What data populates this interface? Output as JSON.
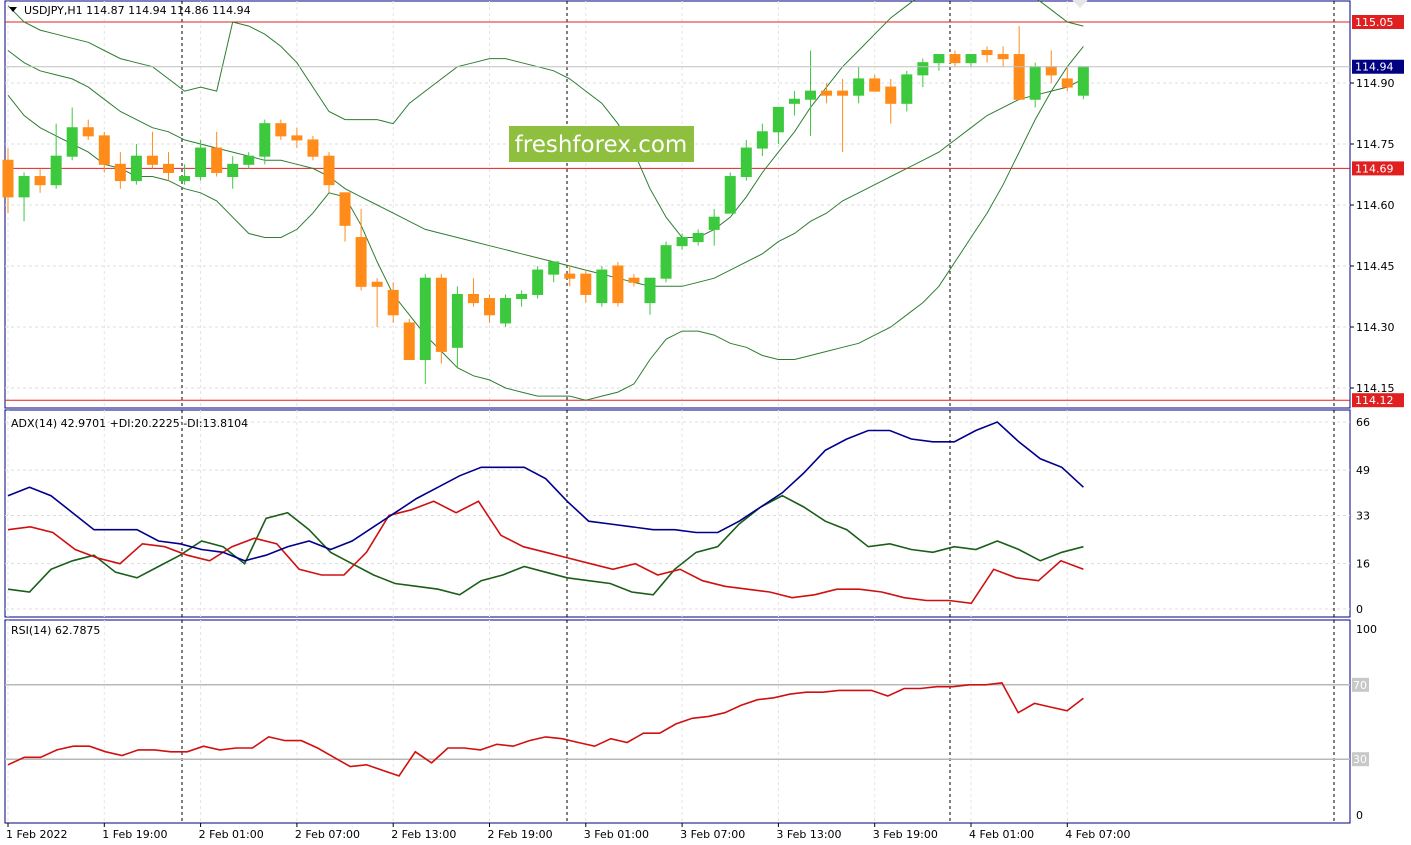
{
  "chart_data": {
    "type": "candlestick",
    "symbol_header": "USDJPY,H1  114.87 114.94 114.86 114.94",
    "watermark": "freshforex.com",
    "colors": {
      "bull": "#3dc93d",
      "bear": "#ff8c1a",
      "frame": "#000080",
      "hline": "#e02020",
      "hline_label_bg": "#e02020",
      "price_label_bg": "#000080",
      "bands": "#2e7d32",
      "adx": "#00008b",
      "plus_di": "#1a5e1a",
      "minus_di": "#d01010",
      "rsi": "#d01010",
      "watermark_bg": "#8fbf3f"
    },
    "main_panel": {
      "ylim": [
        114.1,
        115.1
      ],
      "y_ticks": [
        "114.90",
        "114.75",
        "114.60",
        "114.45",
        "114.30",
        "114.15"
      ],
      "y_tick_values": [
        114.9,
        114.75,
        114.6,
        114.45,
        114.3,
        114.15
      ],
      "horizontal_lines": [
        {
          "value": 115.05,
          "label": "115.05"
        },
        {
          "value": 114.69,
          "label": "114.69"
        },
        {
          "value": 114.12,
          "label": "114.12"
        }
      ],
      "current_price": {
        "value": 114.94,
        "label": "114.94"
      },
      "candles": [
        [
          114.71,
          114.74,
          114.58,
          114.62
        ],
        [
          114.62,
          114.68,
          114.56,
          114.67
        ],
        [
          114.67,
          114.69,
          114.63,
          114.65
        ],
        [
          114.65,
          114.8,
          114.64,
          114.72
        ],
        [
          114.72,
          114.84,
          114.71,
          114.79
        ],
        [
          114.79,
          114.81,
          114.76,
          114.77
        ],
        [
          114.77,
          114.78,
          114.68,
          114.7
        ],
        [
          114.7,
          114.73,
          114.64,
          114.66
        ],
        [
          114.66,
          114.75,
          114.65,
          114.72
        ],
        [
          114.72,
          114.78,
          114.69,
          114.7
        ],
        [
          114.7,
          114.73,
          114.66,
          114.68
        ],
        [
          114.66,
          114.7,
          114.65,
          114.67
        ],
        [
          114.67,
          114.76,
          114.66,
          114.74
        ],
        [
          114.74,
          114.78,
          114.67,
          114.68
        ],
        [
          114.67,
          114.72,
          114.64,
          114.7
        ],
        [
          114.7,
          114.73,
          114.69,
          114.72
        ],
        [
          114.72,
          114.81,
          114.7,
          114.8
        ],
        [
          114.8,
          114.81,
          114.76,
          114.77
        ],
        [
          114.77,
          114.79,
          114.74,
          114.76
        ],
        [
          114.76,
          114.77,
          114.71,
          114.72
        ],
        [
          114.72,
          114.73,
          114.63,
          114.65
        ],
        [
          114.63,
          114.63,
          114.51,
          114.55
        ],
        [
          114.52,
          114.59,
          114.39,
          114.4
        ],
        [
          114.41,
          114.42,
          114.3,
          114.4
        ],
        [
          114.39,
          114.41,
          114.31,
          114.33
        ],
        [
          114.31,
          114.32,
          114.23,
          114.22
        ],
        [
          114.22,
          114.43,
          114.16,
          114.42
        ],
        [
          114.42,
          114.43,
          114.21,
          114.24
        ],
        [
          114.25,
          114.4,
          114.2,
          114.38
        ],
        [
          114.38,
          114.42,
          114.35,
          114.36
        ],
        [
          114.37,
          114.38,
          114.31,
          114.33
        ],
        [
          114.31,
          114.38,
          114.3,
          114.37
        ],
        [
          114.37,
          114.39,
          114.35,
          114.38
        ],
        [
          114.38,
          114.45,
          114.37,
          114.44
        ],
        [
          114.43,
          114.46,
          114.41,
          114.46
        ],
        [
          114.43,
          114.45,
          114.4,
          114.42
        ],
        [
          114.43,
          114.44,
          114.36,
          114.38
        ],
        [
          114.36,
          114.45,
          114.35,
          114.44
        ],
        [
          114.45,
          114.46,
          114.35,
          114.36
        ],
        [
          114.42,
          114.43,
          114.4,
          114.41
        ],
        [
          114.36,
          114.42,
          114.33,
          114.42
        ],
        [
          114.42,
          114.51,
          114.41,
          114.5
        ],
        [
          114.5,
          114.53,
          114.49,
          114.52
        ],
        [
          114.51,
          114.54,
          114.5,
          114.53
        ],
        [
          114.54,
          114.59,
          114.5,
          114.57
        ],
        [
          114.58,
          114.68,
          114.58,
          114.67
        ],
        [
          114.67,
          114.76,
          114.66,
          114.74
        ],
        [
          114.74,
          114.8,
          114.72,
          114.78
        ],
        [
          114.78,
          114.84,
          114.75,
          114.84
        ],
        [
          114.85,
          114.88,
          114.82,
          114.86
        ],
        [
          114.86,
          114.98,
          114.77,
          114.88
        ],
        [
          114.88,
          114.9,
          114.85,
          114.87
        ],
        [
          114.88,
          114.91,
          114.73,
          114.87
        ],
        [
          114.87,
          114.94,
          114.85,
          114.91
        ],
        [
          114.91,
          114.92,
          114.88,
          114.88
        ],
        [
          114.89,
          114.91,
          114.8,
          114.85
        ],
        [
          114.85,
          114.93,
          114.83,
          114.92
        ],
        [
          114.92,
          114.96,
          114.89,
          114.95
        ],
        [
          114.95,
          114.97,
          114.93,
          114.97
        ],
        [
          114.97,
          114.98,
          114.94,
          114.95
        ],
        [
          114.95,
          114.97,
          114.94,
          114.97
        ],
        [
          114.98,
          114.99,
          114.95,
          114.97
        ],
        [
          114.97,
          114.99,
          114.94,
          114.96
        ],
        [
          114.97,
          115.04,
          114.86,
          114.86
        ],
        [
          114.86,
          114.95,
          114.84,
          114.94
        ],
        [
          114.94,
          114.98,
          114.9,
          114.92
        ],
        [
          114.91,
          114.94,
          114.88,
          114.89
        ],
        [
          114.87,
          114.94,
          114.86,
          114.94
        ]
      ],
      "bollinger": {
        "upper": [
          115.09,
          115.05,
          115.03,
          115.02,
          115.01,
          115.0,
          114.98,
          114.96,
          114.95,
          114.94,
          114.91,
          114.88,
          114.89,
          114.88,
          115.05,
          115.04,
          115.02,
          114.99,
          114.95,
          114.89,
          114.83,
          114.81,
          114.81,
          114.81,
          114.8,
          114.85,
          114.88,
          114.91,
          114.94,
          114.95,
          114.96,
          114.96,
          114.95,
          114.94,
          114.93,
          114.91,
          114.88,
          114.85,
          114.8,
          114.73,
          114.64,
          114.57,
          114.52,
          114.52,
          114.54,
          114.57,
          114.62,
          114.68,
          114.73,
          114.78,
          114.84,
          114.89,
          114.94,
          114.98,
          115.02,
          115.06,
          115.09,
          115.12,
          115.14,
          115.16,
          115.18,
          115.18,
          115.16,
          115.13,
          115.11,
          115.08,
          115.05,
          115.04
        ],
        "middle": [
          114.98,
          114.95,
          114.93,
          114.92,
          114.91,
          114.89,
          114.86,
          114.83,
          114.81,
          114.79,
          114.78,
          114.76,
          114.75,
          114.74,
          114.73,
          114.72,
          114.71,
          114.71,
          114.7,
          114.69,
          114.67,
          114.64,
          114.62,
          114.6,
          114.58,
          114.56,
          114.54,
          114.53,
          114.52,
          114.51,
          114.5,
          114.49,
          114.48,
          114.47,
          114.46,
          114.45,
          114.44,
          114.43,
          114.42,
          114.41,
          114.4,
          114.4,
          114.4,
          114.41,
          114.42,
          114.44,
          114.46,
          114.48,
          114.51,
          114.53,
          114.56,
          114.58,
          114.61,
          114.63,
          114.65,
          114.67,
          114.69,
          114.71,
          114.73,
          114.76,
          114.79,
          114.82,
          114.84,
          114.86,
          114.87,
          114.88,
          114.89,
          114.91
        ],
        "lower": [
          114.87,
          114.82,
          114.79,
          114.77,
          114.75,
          114.73,
          114.7,
          114.69,
          114.67,
          114.67,
          114.66,
          114.64,
          114.63,
          114.61,
          114.57,
          114.53,
          114.52,
          114.52,
          114.54,
          114.58,
          114.63,
          114.62,
          114.55,
          114.46,
          114.38,
          114.33,
          114.28,
          114.24,
          114.2,
          114.18,
          114.17,
          114.15,
          114.14,
          114.13,
          114.13,
          114.13,
          114.12,
          114.13,
          114.14,
          114.16,
          114.22,
          114.27,
          114.29,
          114.29,
          114.28,
          114.26,
          114.25,
          114.23,
          114.22,
          114.22,
          114.23,
          114.24,
          114.25,
          114.26,
          114.28,
          114.3,
          114.33,
          114.36,
          114.4,
          114.46,
          114.52,
          114.58,
          114.65,
          114.73,
          114.81,
          114.88,
          114.94,
          114.99
        ]
      }
    },
    "adx_panel": {
      "header": "ADX(14) 42.9701 +DI:20.2225 -DI:13.8104",
      "ylim": [
        0,
        68
      ],
      "y_ticks": [
        "66",
        "49",
        "33",
        "16",
        "0"
      ],
      "y_tick_values": [
        66,
        49,
        33,
        16,
        0
      ],
      "adx": [
        40,
        43,
        40,
        34,
        28,
        28,
        28,
        24,
        23,
        21,
        20,
        17,
        19,
        22,
        24,
        21,
        24,
        29,
        34,
        39,
        43,
        47,
        50,
        50,
        50,
        46,
        38,
        31,
        30,
        29,
        28,
        28,
        27,
        27,
        31,
        36,
        41,
        48,
        56,
        60,
        63,
        63,
        60,
        59,
        59,
        63,
        66,
        59,
        53,
        50,
        43
      ],
      "plus_di": [
        7,
        6,
        14,
        17,
        19,
        13,
        11,
        15,
        19,
        24,
        22,
        16,
        32,
        34,
        28,
        20,
        16,
        12,
        9,
        8,
        7,
        5,
        10,
        12,
        15,
        13,
        11,
        10,
        9,
        6,
        5,
        14,
        20,
        22,
        30,
        36,
        40,
        36,
        31,
        28,
        22,
        23,
        21,
        20,
        22,
        21,
        24,
        21,
        17,
        20,
        22
      ],
      "minus_di": [
        28,
        29,
        27,
        21,
        18,
        16,
        23,
        22,
        19,
        17,
        22,
        25,
        23,
        14,
        12,
        12,
        20,
        33,
        35,
        38,
        34,
        38,
        26,
        22,
        20,
        18,
        16,
        14,
        16,
        12,
        14,
        10,
        8,
        7,
        6,
        4,
        5,
        7,
        7,
        6,
        4,
        3,
        3,
        2,
        14,
        11,
        10,
        17,
        14
      ],
      "minus_di_scale": 1
    },
    "rsi_panel": {
      "header": "RSI(14) 62.7875",
      "ylim": [
        0,
        100
      ],
      "y_ticks": [
        "100",
        "70",
        "30",
        "0"
      ],
      "y_tick_values": [
        100,
        70,
        30,
        0
      ],
      "levels": [
        70,
        30
      ],
      "values": [
        27,
        31,
        31,
        35,
        37,
        37,
        34,
        32,
        35,
        35,
        34,
        34,
        37,
        35,
        36,
        36,
        42,
        40,
        40,
        36,
        31,
        26,
        27,
        24,
        21,
        34,
        28,
        36,
        36,
        35,
        38,
        37,
        40,
        42,
        41,
        39,
        37,
        41,
        39,
        44,
        44,
        49,
        52,
        53,
        55,
        59,
        62,
        63,
        65,
        66,
        66,
        67,
        67,
        67,
        64,
        68,
        68,
        69,
        69,
        70,
        70,
        71,
        55,
        60,
        58,
        56,
        62.79
      ]
    },
    "x_axis": {
      "tick_labels": [
        "1 Feb 2022",
        "1 Feb 19:00",
        "2 Feb 01:00",
        "2 Feb 07:00",
        "2 Feb 13:00",
        "2 Feb 19:00",
        "3 Feb 01:00",
        "3 Feb 07:00",
        "3 Feb 13:00",
        "3 Feb 19:00",
        "4 Feb 01:00",
        "4 Feb 07:00"
      ]
    },
    "day_separators": [
      "2 Feb",
      "3 Feb",
      "4 Feb"
    ]
  }
}
